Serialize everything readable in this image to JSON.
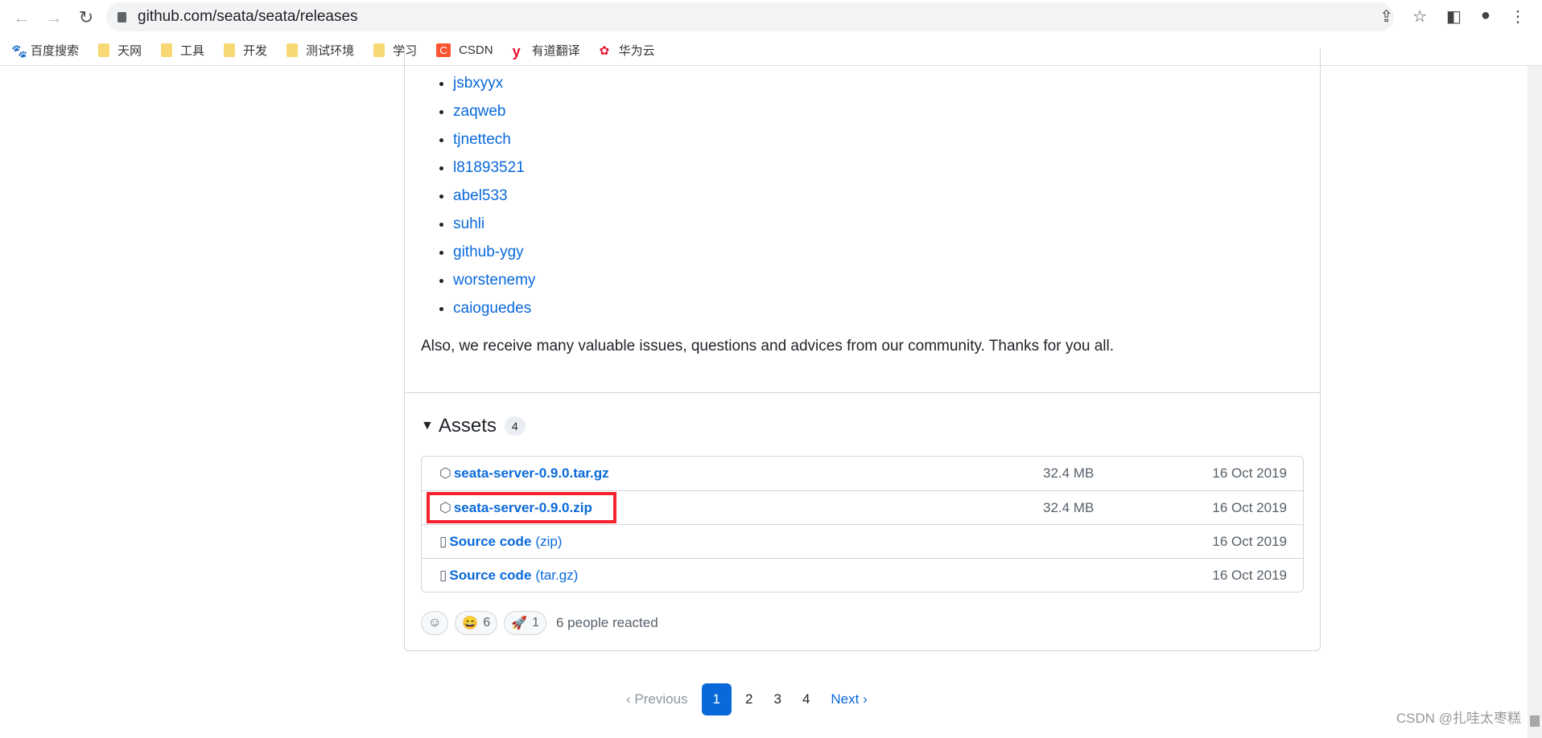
{
  "browser": {
    "url": "github.com/seata/seata/releases"
  },
  "bookmarks": [
    {
      "label": "百度搜索",
      "icon": "baidu-icon"
    },
    {
      "label": "天网",
      "icon": "folder-icon"
    },
    {
      "label": "工具",
      "icon": "folder-icon"
    },
    {
      "label": "开发",
      "icon": "folder-icon"
    },
    {
      "label": "测试环境",
      "icon": "folder-icon"
    },
    {
      "label": "学习",
      "icon": "folder-icon"
    },
    {
      "label": "CSDN",
      "icon": "csdn-icon"
    },
    {
      "label": "有道翻译",
      "icon": "youdao-icon"
    },
    {
      "label": "华为云",
      "icon": "huawei-icon"
    }
  ],
  "contributors": [
    "jsbxyyx",
    "zaqweb",
    "tjnettech",
    "l81893521",
    "abel533",
    "suhli",
    "github-ygy",
    "worstenemy",
    "caioguedes"
  ],
  "thanks": "Also, we receive many valuable issues, questions and advices from our community. Thanks for you all.",
  "assets": {
    "title": "Assets",
    "count": "4",
    "items": [
      {
        "name": "seata-server-0.9.0.tar.gz",
        "sub": "",
        "size": "32.4 MB",
        "date": "16 Oct 2019"
      },
      {
        "name": "seata-server-0.9.0.zip",
        "sub": "",
        "size": "32.4 MB",
        "date": "16 Oct 2019"
      },
      {
        "name": "Source code",
        "sub": "(zip)",
        "size": "",
        "date": "16 Oct 2019"
      },
      {
        "name": "Source code",
        "sub": "(tar.gz)",
        "size": "",
        "date": "16 Oct 2019"
      }
    ]
  },
  "reactions": {
    "smile_count": "6",
    "rocket_count": "1",
    "summary": "6 people reacted"
  },
  "pagination": {
    "prev": "Previous",
    "pages": [
      "1",
      "2",
      "3",
      "4"
    ],
    "current": "1",
    "next": "Next"
  },
  "watermark": "CSDN @扎哇太枣糕",
  "highlight_color": "#f5222d"
}
